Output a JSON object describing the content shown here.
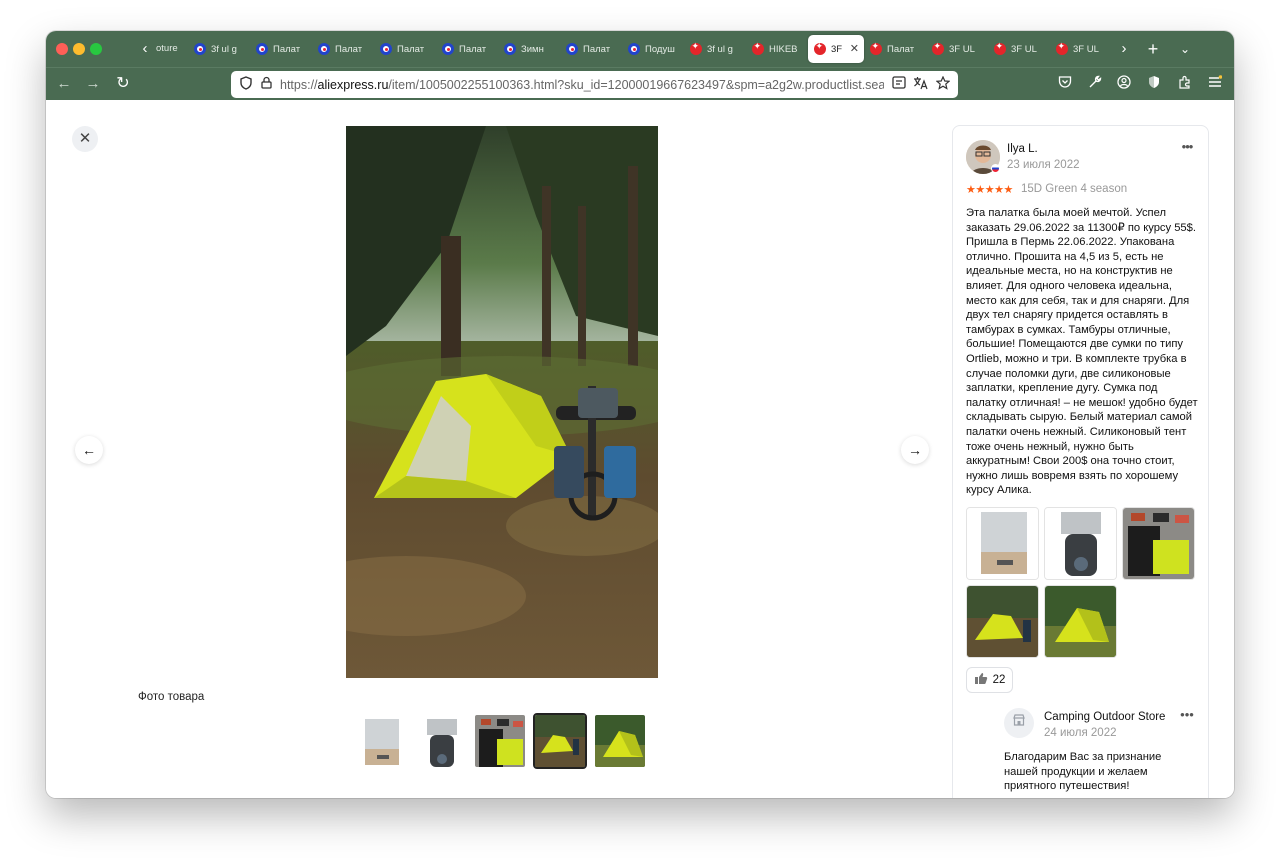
{
  "browser": {
    "first_tab_fragment": "oture",
    "tabs": [
      {
        "label": "3f ul g",
        "favicon": "aliexpress-blue"
      },
      {
        "label": "Палат",
        "favicon": "aliexpress-blue"
      },
      {
        "label": "Палат",
        "favicon": "aliexpress-blue"
      },
      {
        "label": "Палат",
        "favicon": "aliexpress-blue"
      },
      {
        "label": "Палат",
        "favicon": "aliexpress-blue"
      },
      {
        "label": "Зимн",
        "favicon": "aliexpress-blue"
      },
      {
        "label": "Палат",
        "favicon": "aliexpress-blue"
      },
      {
        "label": "Подуш",
        "favicon": "aliexpress-blue"
      },
      {
        "label": "3f ul g",
        "favicon": "aliexpress-red"
      },
      {
        "label": "HIKEB",
        "favicon": "aliexpress-red"
      },
      {
        "label": "3F",
        "favicon": "aliexpress-red",
        "active": true
      },
      {
        "label": "Палат",
        "favicon": "aliexpress-red"
      },
      {
        "label": "3F UL",
        "favicon": "aliexpress-red"
      },
      {
        "label": "3F UL",
        "favicon": "aliexpress-red"
      },
      {
        "label": "3F UL",
        "favicon": "aliexpress-red"
      }
    ],
    "url_prefix": "https://",
    "url_domain": "aliexpress.ru",
    "url_path": "/item/1005002255100363.html?sku_id=12000019667623497&spm=a2g2w.productlist.search_re",
    "icons": {
      "close": "close-traffic-light",
      "back": "←",
      "forward": "→",
      "reload": "↻",
      "new_tab": "+",
      "tab_list": "⌄",
      "tab_scroll_left": "‹",
      "tab_scroll_right": "›",
      "menu": "≡"
    },
    "colors": {
      "chrome": "#4a6b52",
      "active_tab": "#ffffff"
    }
  },
  "viewer": {
    "close_icon": "✕",
    "prev_icon": "←",
    "next_icon": "→",
    "caption": "Фото товара",
    "thumbnails": [
      "tent-box-photo",
      "tent-bag-photo",
      "tent-contents-photo",
      "tent-campsite-photo",
      "tent-meadow-photo"
    ],
    "selected_thumbnail": "tent-campsite-photo",
    "main_photo": "tent-campsite-photo"
  },
  "review": {
    "reviewer": "Ilya L.",
    "date": "23 июля 2022",
    "stars": "★★★★★",
    "rating": 5,
    "variant": "15D Green 4 season",
    "text": "Эта палатка была моей мечтой. Успел заказать 29.06.2022 за 11300₽ по курсу 55$. Пришла в Пермь 22.06.2022. Упакована отлично. Прошита на 4,5 из 5, есть не идеальные места, но на конструктив не влияет.  Для одного человека идеальна, место как для себя, так и для снаряги. Для двух тел снарягу придется оставлять в тамбурах в сумках. Тамбуры отличные, большие! Помещаются две сумки по типу Ortlieb, можно и три. В комплекте  трубка в случае поломки дуги, две силиконовые заплатки, крепление дугу. Сумка под палатку отличная! – не мешок! удобно будет складывать сырую. Белый материал самой палатки очень нежный. Силиконовый тент тоже очень нежный, нужно быть аккуратным!  Свои 200$ она точно стоит, нужно лишь вовремя взять по хорошему курсу Алика.",
    "photos": [
      "tent-box-photo",
      "tent-bag-photo",
      "tent-contents-photo",
      "tent-campsite-photo",
      "tent-meadow-photo"
    ],
    "likes": "22",
    "star_color": "#fd5d13"
  },
  "seller_reply": {
    "name": "Camping Outdoor Store",
    "date": "24 июля 2022",
    "text": "Благодарим Вас за признание нашей продукции и желаем приятного путешествия!"
  }
}
